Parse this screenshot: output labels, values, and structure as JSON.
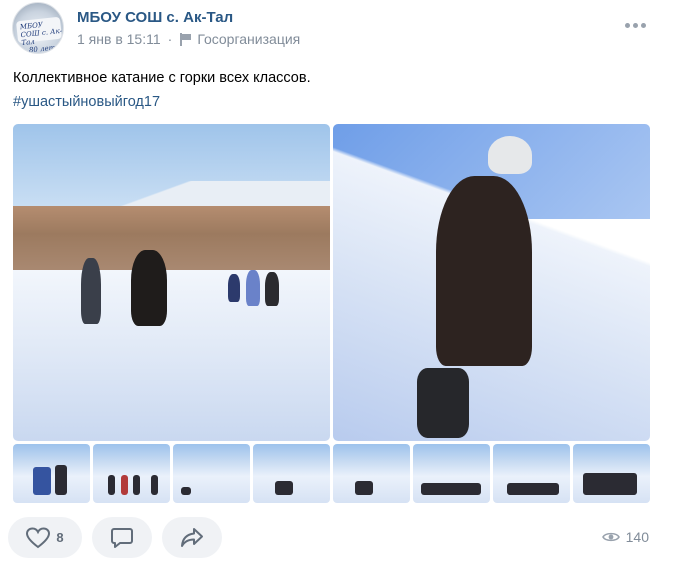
{
  "post": {
    "author": "МБОУ СОШ с. Ак-Тал",
    "date": "1 янв в 15:11",
    "separator": "·",
    "author_type": "Госорганизация",
    "text": "Коллективное катание с горки всех классов.",
    "hashtag": "#ушастыйновыйгод17",
    "avatar_text": "МБОУ СОШ с. Ак-Тал 80 лет"
  },
  "photos": {
    "main_count": 2,
    "thumbnail_count": 8
  },
  "actions": {
    "like_count": "8",
    "views_count": "140"
  },
  "icons": [
    "more-icon",
    "flag-icon",
    "heart-icon",
    "comment-icon",
    "share-icon",
    "eye-icon"
  ],
  "colors": {
    "link": "#2a5885",
    "secondary_text": "#818c99",
    "button_bg": "#f0f2f5",
    "icon_gray": "#99a2ad"
  }
}
